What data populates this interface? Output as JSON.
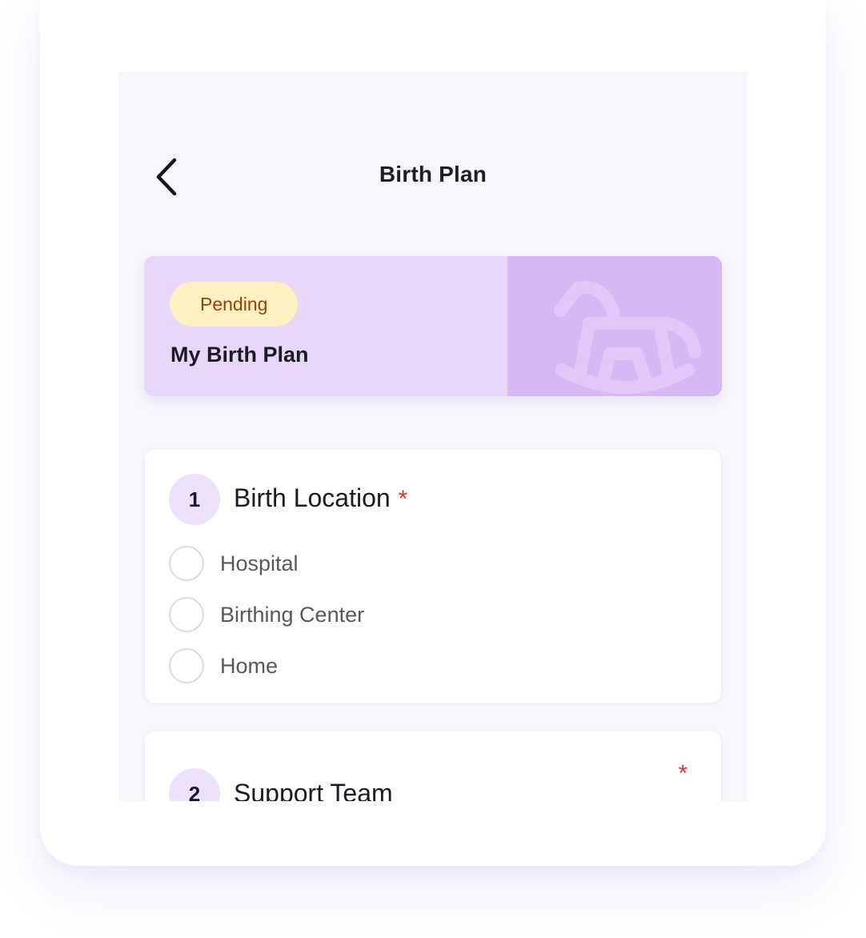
{
  "header": {
    "title": "Birth Plan",
    "back_icon": "chevron-left-icon"
  },
  "plan_card": {
    "status": "Pending",
    "name": "My Birth Plan",
    "illustration_icon": "rocking-horse-icon",
    "colors": {
      "card_bg": "#e9d7f9",
      "art_bg": "#d6b8f4",
      "status_bg": "#fdf1c1",
      "status_text": "#96400f"
    }
  },
  "sections": [
    {
      "number": "1",
      "title": "Birth Location",
      "required_mark": "*",
      "options": [
        {
          "label": "Hospital"
        },
        {
          "label": "Birthing Center"
        },
        {
          "label": "Home"
        }
      ]
    },
    {
      "number": "2",
      "title": "Support Team",
      "required_mark": "*"
    }
  ],
  "colors": {
    "screen_bg": "#f8f5fc",
    "accent_light": "#ede1fb",
    "required": "#d5393f"
  }
}
